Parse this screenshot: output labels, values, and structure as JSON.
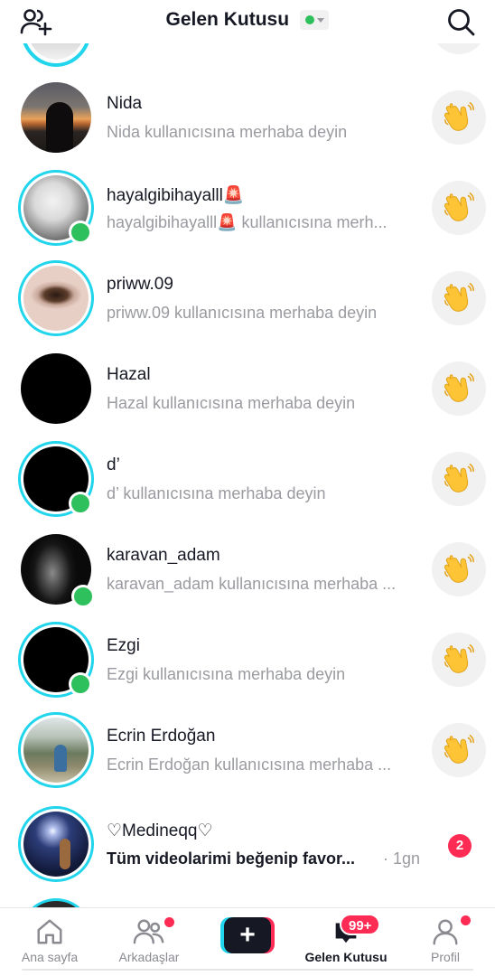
{
  "header": {
    "title": "Gelen Kutusu",
    "left_icon": "add-friends-icon",
    "right_icon": "search-icon",
    "status_color": "#2ec05c"
  },
  "rows": [
    {
      "name": "Nida",
      "subtitle": "Nida kullanıcısına merhaba deyin",
      "ring": false,
      "online": false,
      "action": "wave"
    },
    {
      "name": "hayalgibihayalll🚨",
      "subtitle": "hayalgibihayalll🚨 kullanıcısına merh...",
      "ring": true,
      "online": true,
      "action": "wave"
    },
    {
      "name": "priww.09",
      "subtitle": "priww.09 kullanıcısına merhaba deyin",
      "ring": true,
      "online": false,
      "action": "wave"
    },
    {
      "name": "Hazal",
      "subtitle": "Hazal kullanıcısına merhaba deyin",
      "ring": false,
      "online": false,
      "action": "wave"
    },
    {
      "name": "d’",
      "subtitle": "d’ kullanıcısına merhaba deyin",
      "ring": true,
      "online": true,
      "action": "wave"
    },
    {
      "name": "karavan_adam",
      "subtitle": "karavan_adam kullanıcısına merhaba ...",
      "ring": false,
      "online": true,
      "action": "wave"
    },
    {
      "name": "Ezgi",
      "subtitle": "Ezgi kullanıcısına merhaba deyin",
      "ring": true,
      "online": true,
      "action": "wave"
    },
    {
      "name": "Ecrin Erdoğan",
      "subtitle": "Ecrin Erdoğan kullanıcısına merhaba ...",
      "ring": true,
      "online": false,
      "action": "wave"
    },
    {
      "name": "♡Medineqq♡",
      "subtitle": "Tüm videolarimi beğenip favor...",
      "time": "· 1gn",
      "unread": "2",
      "ring": true,
      "online": false,
      "action": "badge"
    }
  ],
  "tabbar": {
    "home": "Ana sayfa",
    "friends": "Arkadaşlar",
    "create": "+",
    "inbox": "Gelen Kutusu",
    "inbox_badge": "99+",
    "profile": "Profil",
    "accent_red": "#fe2c55",
    "accent_cyan": "#20d5ec"
  }
}
